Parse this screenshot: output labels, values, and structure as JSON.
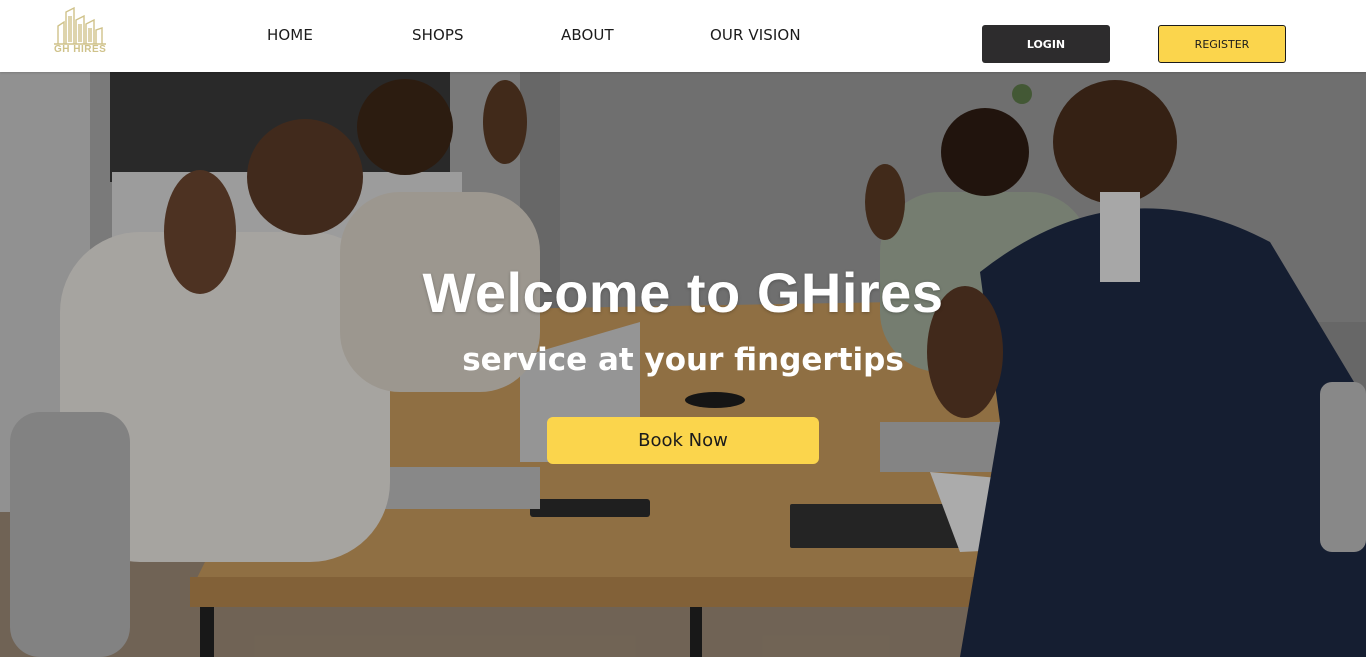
{
  "brand": {
    "logo_text": "GH HIRES",
    "logo_color": "#cfc28a"
  },
  "nav": {
    "items": [
      {
        "label": "HOME"
      },
      {
        "label": "SHOPS"
      },
      {
        "label": "ABOUT"
      },
      {
        "label": "OUR VISION"
      }
    ]
  },
  "auth": {
    "login_label": "LOGIN",
    "register_label": "REGISTER"
  },
  "hero": {
    "title": "Welcome to GHires",
    "subtitle": "service at your fingertips",
    "cta_label": "Book Now",
    "background_image": "office-team-waving-photo"
  },
  "colors": {
    "accent": "#fbd54c",
    "dark_button": "#2d2c2d",
    "header_bg": "#ffffff",
    "hero_text": "#ffffff"
  }
}
